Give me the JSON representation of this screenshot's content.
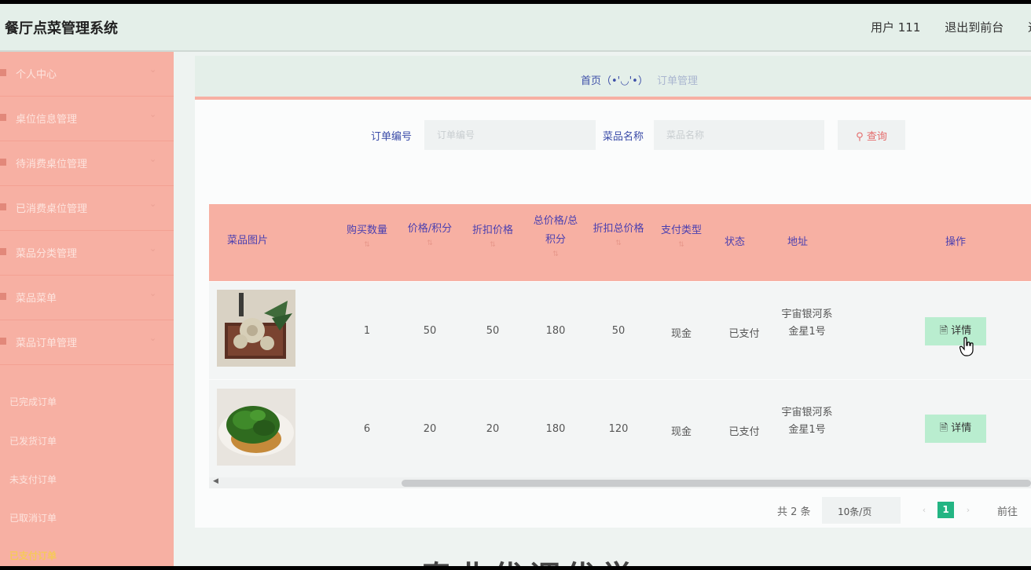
{
  "app": {
    "title": "餐厅点菜管理系统"
  },
  "header": {
    "user": "用户 111",
    "exit_front": "退出到前台",
    "exit_more": "退"
  },
  "sidebar": {
    "items": [
      {
        "label": "个人中心"
      },
      {
        "label": "桌位信息管理"
      },
      {
        "label": "待消费桌位管理"
      },
      {
        "label": "已消费桌位管理"
      },
      {
        "label": "菜品分类管理"
      },
      {
        "label": "菜品菜单"
      },
      {
        "label": "菜品订单管理"
      }
    ],
    "subitems": [
      {
        "label": "已完成订单"
      },
      {
        "label": "已发货订单"
      },
      {
        "label": "未支付订单"
      },
      {
        "label": "已取消订单"
      },
      {
        "label": "已支付订单"
      }
    ]
  },
  "breadcrumb": {
    "home": "首页（•'◡'•）",
    "current": "订单管理"
  },
  "search": {
    "order_label": "订单编号",
    "order_placeholder": "订单编号",
    "dish_label": "菜品名称",
    "dish_placeholder": "菜品名称",
    "button_label": "查询"
  },
  "table": {
    "columns": [
      "菜品图片",
      "购买数量",
      "价格/积分",
      "折扣价格",
      "总价格/总积分",
      "折扣总价格",
      "支付类型",
      "状态",
      "地址",
      "操作"
    ],
    "rows": [
      {
        "quantity": "1",
        "price": "50",
        "discount_price": "50",
        "total": "180",
        "discount_total": "50",
        "pay_type": "现金",
        "status": "已支付",
        "address": "宇宙银河系金星1号",
        "action": "详情"
      },
      {
        "quantity": "6",
        "price": "20",
        "discount_price": "20",
        "total": "180",
        "discount_total": "120",
        "pay_type": "现金",
        "status": "已支付",
        "address": "宇宙银河系金星1号",
        "action": "详情"
      }
    ]
  },
  "pagination": {
    "total": "共 2 条",
    "page_size": "10条/页",
    "current_page": "1",
    "goto": "前往"
  },
  "footer": {
    "text": "奉业优调优学"
  },
  "colors": {
    "sidebar": "#f7b0a3",
    "header_bg": "#e4efe9",
    "accent_green": "#23b583",
    "link_blue": "#3d4fa8"
  }
}
